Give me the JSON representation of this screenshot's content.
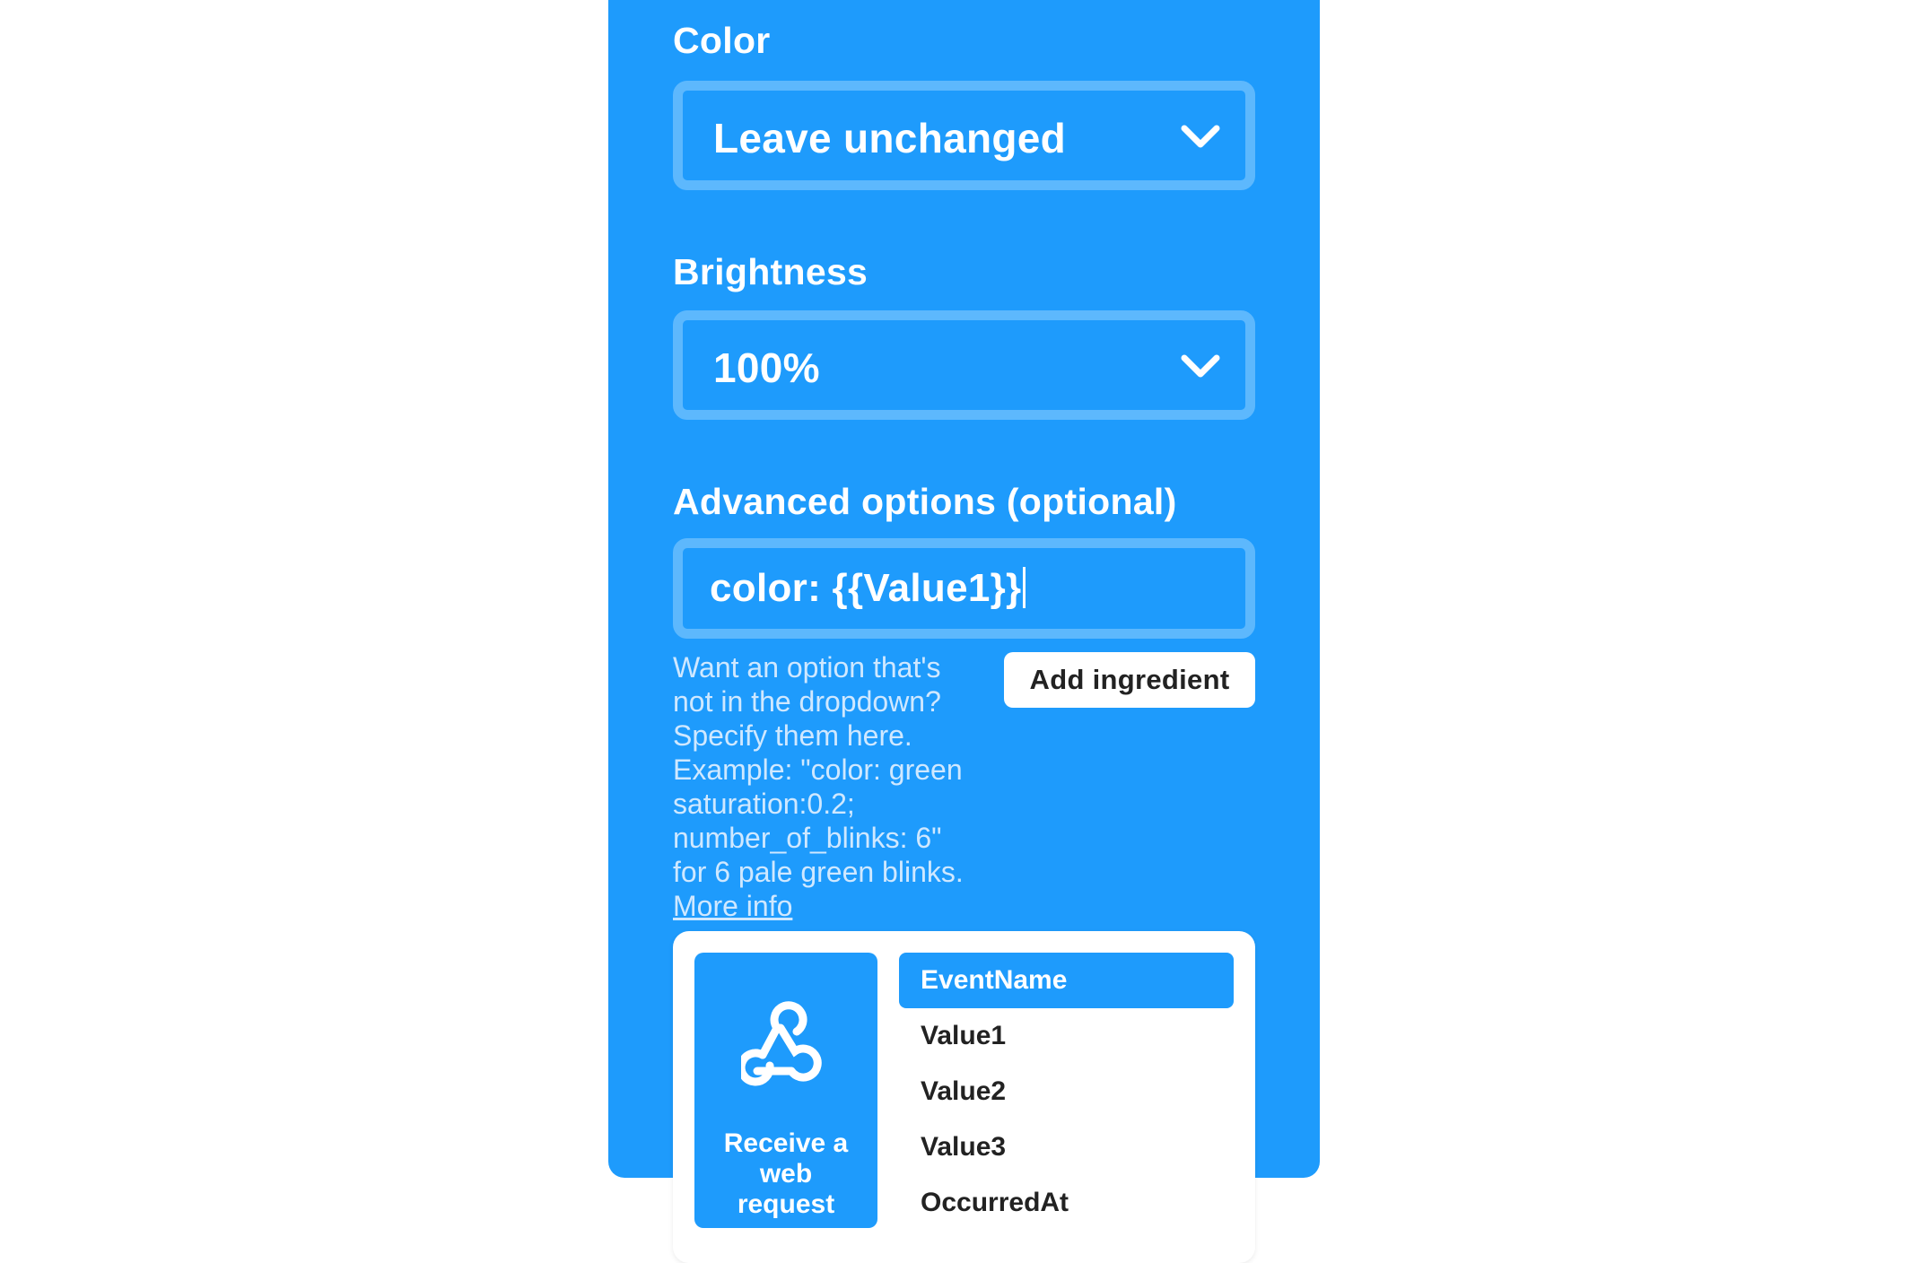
{
  "form": {
    "color": {
      "label": "Color",
      "value": "Leave unchanged",
      "icon": "chevron-down-icon"
    },
    "brightness": {
      "label": "Brightness",
      "value": "100%",
      "icon": "chevron-down-icon"
    },
    "advanced": {
      "label": "Advanced options (optional)",
      "value": "color: {{Value1}}",
      "help_lines": [
        "Want an option that's",
        "not in the dropdown?",
        "Specify them here.",
        "Example: \"color: green",
        "saturation:0.2;",
        "number_of_blinks: 6\"",
        "for 6 pale green blinks."
      ],
      "more_info": "More info",
      "add_ingredient_label": "Add ingredient"
    }
  },
  "ingredient_popup": {
    "trigger": {
      "icon": "webhook-icon",
      "label_lines": [
        "Receive a",
        "web",
        "request"
      ]
    },
    "items": [
      {
        "label": "EventName",
        "selected": true
      },
      {
        "label": "Value1",
        "selected": false
      },
      {
        "label": "Value2",
        "selected": false
      },
      {
        "label": "Value3",
        "selected": false
      },
      {
        "label": "OccurredAt",
        "selected": false
      }
    ]
  },
  "colors": {
    "accent": "#1e9bfc",
    "field_border": "#5db8fd",
    "help_text": "#cfe8ff"
  }
}
